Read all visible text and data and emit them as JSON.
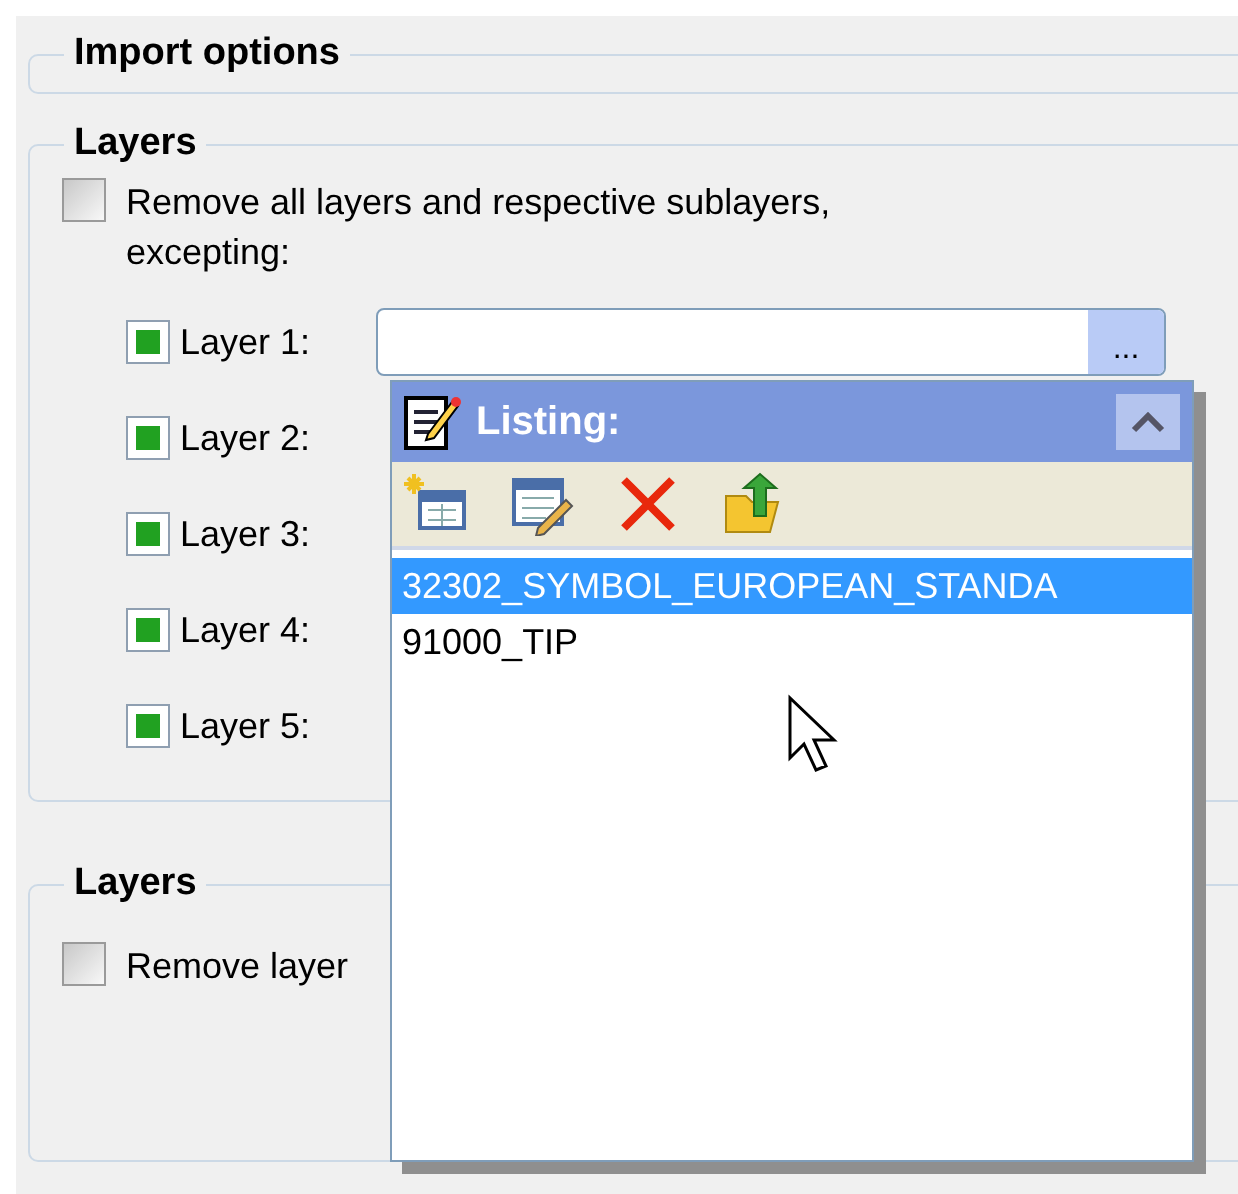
{
  "import_options": {
    "title": "Import options"
  },
  "layers_group_1": {
    "title": "Layers",
    "remove_all": {
      "label": "Remove all layers and respective sublayers, excepting:",
      "checked": false
    },
    "layers": [
      {
        "label": "Layer 1:",
        "checked": true,
        "browse_button": "..."
      },
      {
        "label": "Layer 2:",
        "checked": true
      },
      {
        "label": "Layer 3:",
        "checked": true
      },
      {
        "label": "Layer 4:",
        "checked": true
      },
      {
        "label": "Layer 5:",
        "checked": true
      }
    ]
  },
  "listing_popup": {
    "title": "Listing:",
    "items": [
      {
        "label": "32302_SYMBOL_EUROPEAN_STANDA",
        "selected": true
      },
      {
        "label": "91000_TIP",
        "selected": false
      }
    ]
  },
  "layers_group_2": {
    "title": "Layers",
    "remove_layers": {
      "label": "Remove layer",
      "checked": false
    }
  }
}
